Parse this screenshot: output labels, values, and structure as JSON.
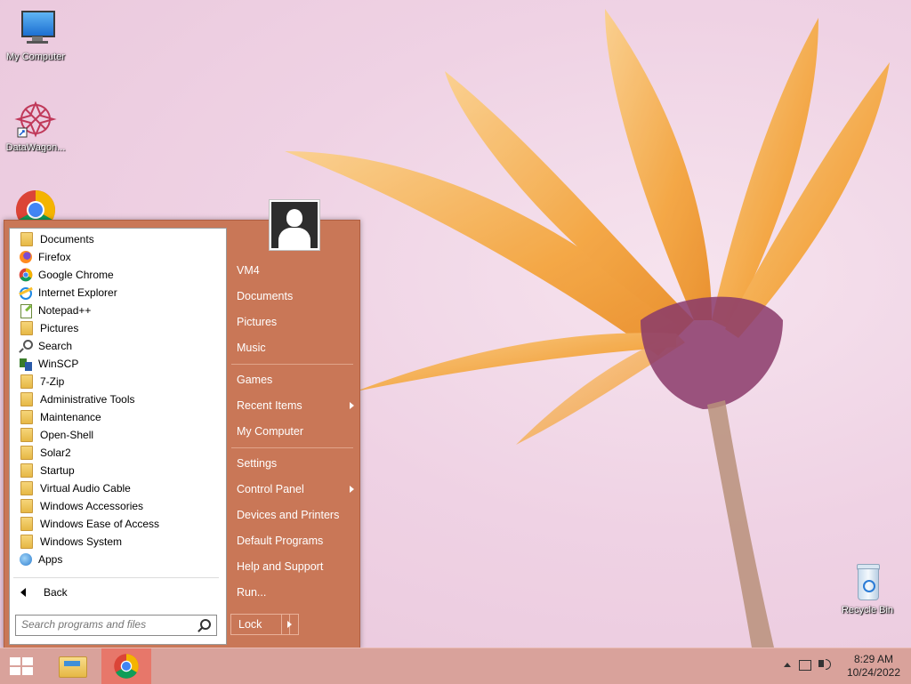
{
  "desktop": {
    "icons": [
      {
        "label": "My Computer",
        "icon": "monitor-icon"
      },
      {
        "label": "DataWagon...",
        "icon": "datawagon-icon"
      },
      {
        "label": "Google Chrome",
        "icon": "chrome-icon"
      },
      {
        "label": "Recycle Bin",
        "icon": "recycle-bin-icon"
      }
    ]
  },
  "start_menu": {
    "programs": [
      {
        "label": "Documents",
        "icon": "documents-icon"
      },
      {
        "label": "Firefox",
        "icon": "firefox-icon"
      },
      {
        "label": "Google Chrome",
        "icon": "chrome-icon"
      },
      {
        "label": "Internet Explorer",
        "icon": "ie-icon"
      },
      {
        "label": "Notepad++",
        "icon": "notepad-icon"
      },
      {
        "label": "Pictures",
        "icon": "pictures-icon"
      },
      {
        "label": "Search",
        "icon": "search-icon"
      },
      {
        "label": "WinSCP",
        "icon": "winscp-icon"
      },
      {
        "label": "7-Zip",
        "icon": "folder-icon"
      },
      {
        "label": "Administrative Tools",
        "icon": "folder-icon"
      },
      {
        "label": "Maintenance",
        "icon": "folder-icon"
      },
      {
        "label": "Open-Shell",
        "icon": "folder-icon"
      },
      {
        "label": "Solar2",
        "icon": "folder-icon"
      },
      {
        "label": "Startup",
        "icon": "folder-icon"
      },
      {
        "label": "Virtual Audio Cable",
        "icon": "folder-icon"
      },
      {
        "label": "Windows Accessories",
        "icon": "folder-icon"
      },
      {
        "label": "Windows Ease of Access",
        "icon": "folder-icon"
      },
      {
        "label": "Windows System",
        "icon": "folder-icon"
      },
      {
        "label": "Apps",
        "icon": "apps-icon"
      }
    ],
    "back_label": "Back",
    "search_placeholder": "Search programs and files",
    "right_items": [
      {
        "label": "VM4",
        "submenu": false
      },
      {
        "label": "Documents",
        "submenu": false
      },
      {
        "label": "Pictures",
        "submenu": false
      },
      {
        "label": "Music",
        "submenu": false
      },
      {
        "label": "Games",
        "submenu": false
      },
      {
        "label": "Recent Items",
        "submenu": true
      },
      {
        "label": "My Computer",
        "submenu": false
      },
      {
        "label": "Settings",
        "submenu": false
      },
      {
        "label": "Control Panel",
        "submenu": true
      },
      {
        "label": "Devices and Printers",
        "submenu": false
      },
      {
        "label": "Default Programs",
        "submenu": false
      },
      {
        "label": "Help and Support",
        "submenu": false
      },
      {
        "label": "Run...",
        "submenu": false
      }
    ],
    "lock_label": "Lock"
  },
  "taskbar": {
    "apps": [
      {
        "name": "file-explorer",
        "icon": "folder-icon"
      },
      {
        "name": "google-chrome",
        "icon": "chrome-icon",
        "active": true
      }
    ],
    "time": "8:29 AM",
    "date": "10/24/2022"
  },
  "colors": {
    "menu_bg": "#c97757",
    "taskbar_bg": "#d9a29b",
    "active_app": "#e7776a"
  }
}
